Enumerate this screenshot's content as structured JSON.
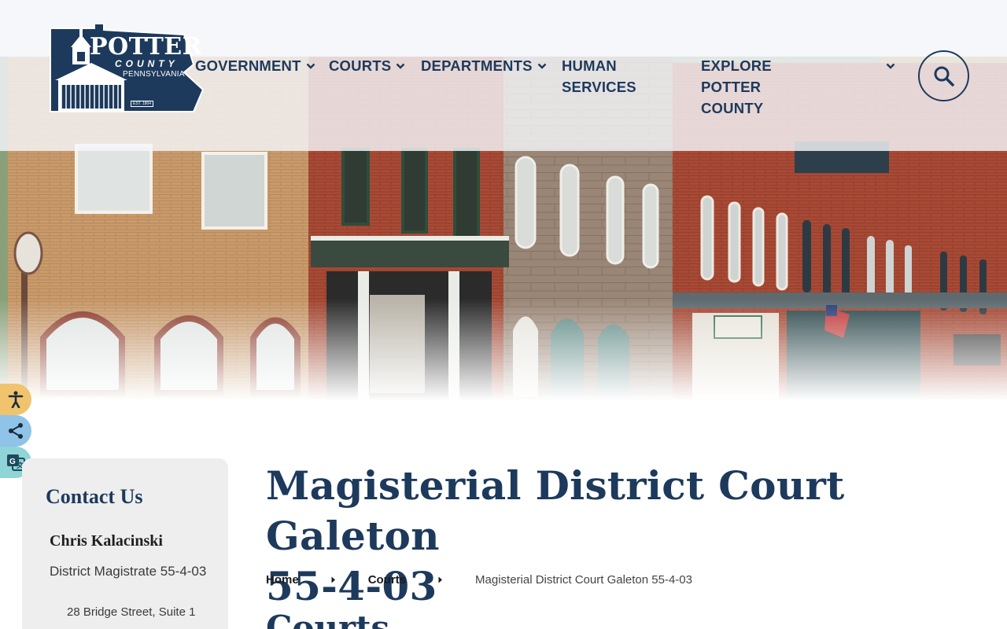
{
  "brand": {
    "logo_name": "POTTER",
    "logo_county": "COUNTY",
    "logo_state": "PENNSYLVANIA",
    "logo_est": "EST. 1804"
  },
  "nav": {
    "items": [
      {
        "label": "GOVERNMENT"
      },
      {
        "label": "COURTS"
      },
      {
        "label": "DEPARTMENTS"
      },
      {
        "label": "HUMAN",
        "label2": "SERVICES"
      },
      {
        "label": "EXPLORE POTTER",
        "label2": "COUNTY"
      }
    ],
    "search_icon": "search-icon"
  },
  "side_tools": [
    {
      "icon": "accessibility-icon",
      "color": "#f0c36d"
    },
    {
      "icon": "share-icon",
      "color": "#8fc3e8"
    },
    {
      "icon": "translate-icon",
      "color": "#8fd4d6"
    }
  ],
  "contact": {
    "heading": "Contact Us",
    "name": "Chris Kalacinski",
    "role": "District Magistrate 55-4-03",
    "address": "28 Bridge Street, Suite 1"
  },
  "page": {
    "title_line1": "Magisterial District Court Galeton",
    "title_line2": "55-4-03",
    "section_heading": "Courts"
  },
  "breadcrumb": {
    "home": "Home",
    "courts": "Courts",
    "current": "Magisterial District Court Galeton 55-4-03"
  },
  "colors": {
    "primary": "#1d3a5c",
    "header_bg": "#f5f7fa",
    "card_bg": "#eeeeee"
  }
}
